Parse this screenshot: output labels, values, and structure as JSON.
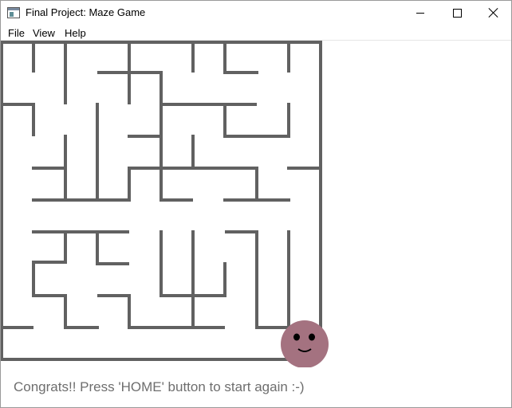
{
  "window": {
    "title": "Final Project: Maze Game",
    "icon": "app-window-icon"
  },
  "menubar": {
    "items": [
      {
        "label": "File"
      },
      {
        "label": "View"
      },
      {
        "label": "Help"
      }
    ]
  },
  "maze": {
    "wall_color": "#616161",
    "background_color": "#ffffff",
    "player": {
      "icon": "smiley-face-icon",
      "color": "#a47280",
      "face_color": "#000000"
    }
  },
  "status": {
    "message": "Congrats!! Press 'HOME' button to start again :-)"
  }
}
